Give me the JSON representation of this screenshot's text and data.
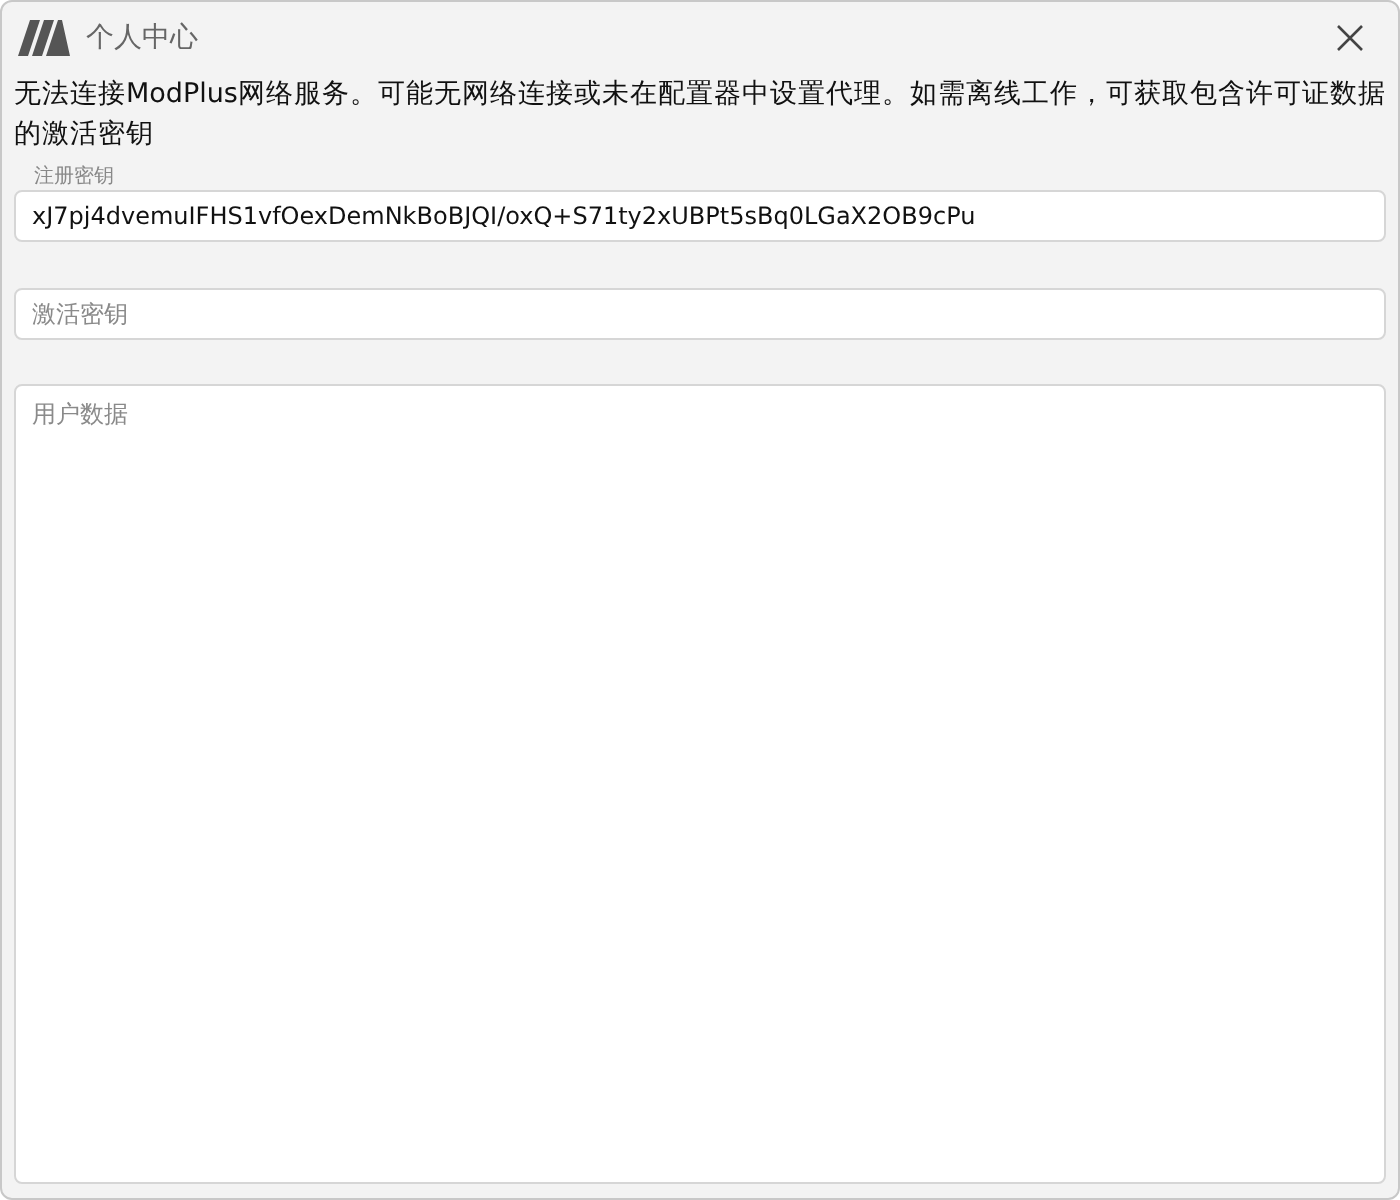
{
  "window": {
    "title": "个人中心"
  },
  "message": "无法连接ModPlus网络服务。可能无网络连接或未在配置器中设置代理。如需离线工作，可获取包含许可证数据的激活密钥",
  "registration_key": {
    "label": "注册密钥",
    "value": "xJ7pj4dvemuIFHS1vfOexDemNkBoBJQI/oxQ+S71ty2xUBPt5sBq0LGaX2OB9cPu"
  },
  "activation_key": {
    "placeholder": "激活密钥"
  },
  "user_data": {
    "placeholder": "用户数据"
  }
}
